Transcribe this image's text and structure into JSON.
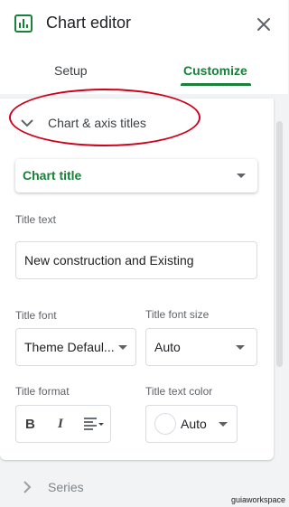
{
  "header": {
    "title": "Chart editor",
    "app_icon": "chart-icon",
    "close_icon": "close-icon"
  },
  "tabs": [
    {
      "label": "Setup",
      "active": false
    },
    {
      "label": "Customize",
      "active": true
    }
  ],
  "section": {
    "label": "Chart & axis titles",
    "icon": "chevron-down-icon",
    "expanded": true
  },
  "title_target": {
    "selected": "Chart title"
  },
  "title_text": {
    "label": "Title text",
    "value": "New construction and Existing"
  },
  "title_font": {
    "label": "Title font",
    "value": "Theme Defaul..."
  },
  "title_font_size": {
    "label": "Title font size",
    "value": "Auto"
  },
  "title_format": {
    "label": "Title format",
    "bold": "B",
    "italic": "I",
    "align_icon": "align-left-icon"
  },
  "title_text_color": {
    "label": "Title text color",
    "value": "Auto",
    "swatch": "#ffffff"
  },
  "next_section": {
    "label": "Series",
    "icon": "chevron-right-icon"
  },
  "watermark": "guiaworkspace",
  "colors": {
    "accent": "#188038",
    "highlight": "#d0021b",
    "text": "#3c4043"
  }
}
